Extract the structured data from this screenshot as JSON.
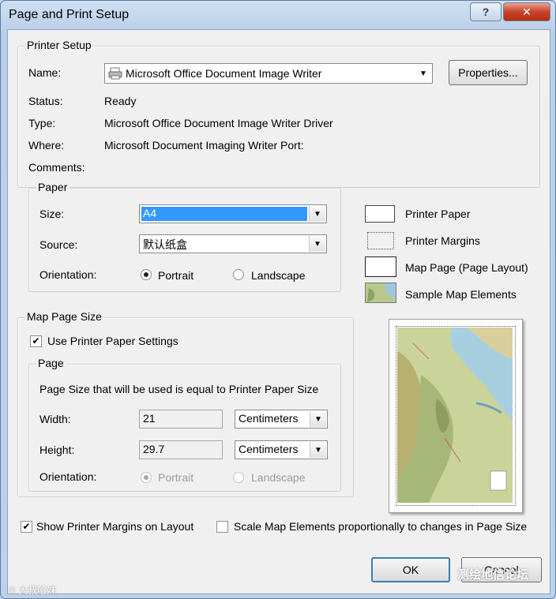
{
  "window": {
    "title": "Page and Print Setup",
    "help_glyph": "?",
    "close_glyph": "✕"
  },
  "printer_setup": {
    "legend": "Printer Setup",
    "name_label": "Name:",
    "name_value": "Microsoft Office Document Image Writer",
    "properties_button": "Properties...",
    "status_label": "Status:",
    "status_value": "Ready",
    "type_label": "Type:",
    "type_value": "Microsoft Office Document Image Writer Driver",
    "where_label": "Where:",
    "where_value": "Microsoft Document Imaging Writer Port:",
    "comments_label": "Comments:"
  },
  "paper": {
    "legend": "Paper",
    "size_label": "Size:",
    "size_value": "A4",
    "source_label": "Source:",
    "source_value": "默认纸盒",
    "orientation_label": "Orientation:",
    "portrait_label": "Portrait",
    "landscape_label": "Landscape",
    "orientation_selected": "Portrait"
  },
  "legend_items": {
    "printer_paper": "Printer Paper",
    "printer_margins": "Printer Margins",
    "map_page": "Map Page (Page Layout)",
    "sample_elements": "Sample Map Elements"
  },
  "map_page_size": {
    "legend": "Map Page Size",
    "use_printer_settings_label": "Use Printer Paper Settings",
    "use_printer_settings_checked": true,
    "page_legend": "Page",
    "info_text": "Page Size that will be used is equal to Printer Paper Size",
    "width_label": "Width:",
    "width_value": "21",
    "width_units": "Centimeters",
    "height_label": "Height:",
    "height_value": "29.7",
    "height_units": "Centimeters",
    "orientation_label": "Orientation:",
    "portrait_label": "Portrait",
    "landscape_label": "Landscape"
  },
  "options": {
    "show_margins_label": "Show Printer Margins on Layout",
    "show_margins_checked": true,
    "scale_elements_label": "Scale Map Elements proportionally to changes in Page Size",
    "scale_elements_checked": false
  },
  "buttons": {
    "ok": "OK",
    "cancel": "Cancel"
  },
  "watermarks": {
    "left": "© 大叔哈妹",
    "right": "测绘地信论坛"
  },
  "colors": {
    "selection": "#3399ff",
    "close": "#c8432b",
    "default_border": "#3c7fb1"
  }
}
